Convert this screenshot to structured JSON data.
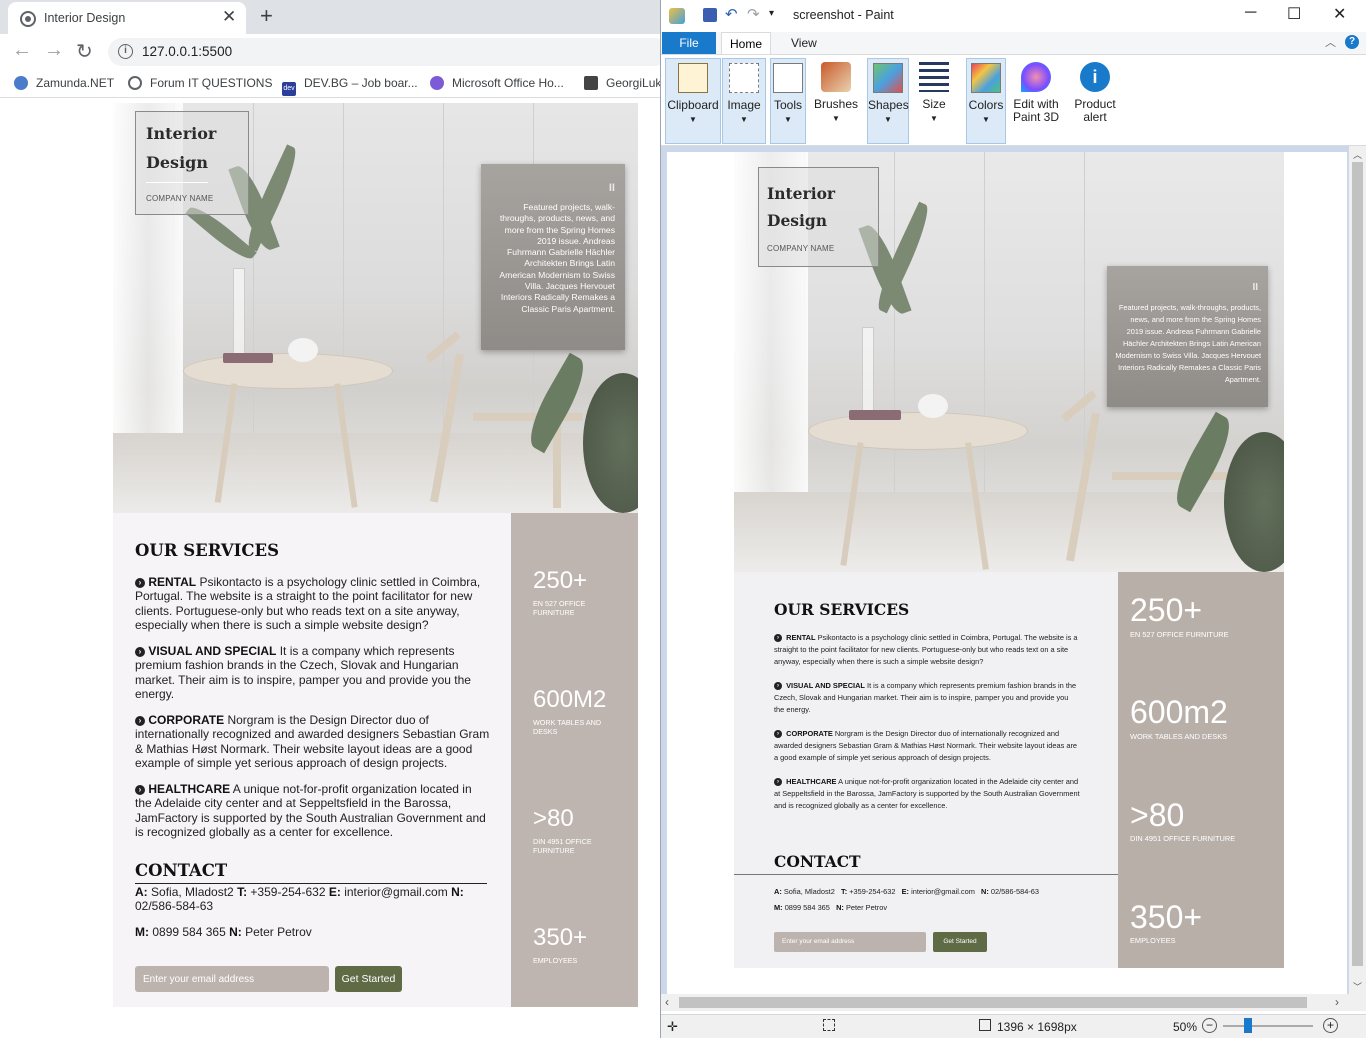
{
  "browser": {
    "tab_title": "Interior Design",
    "tab_close": "✕",
    "new_tab": "+",
    "url": "127.0.0.1:5500",
    "bookmarks": [
      "Zamunda.NET",
      "Forum IT QUESTIONS",
      "DEV.BG – Job boar...",
      "Microsoft Office Ho...",
      "GeorgiLuk"
    ],
    "bookmark_dev_icon": "dev"
  },
  "site": {
    "logo_line1": "Interior",
    "logo_line2": "Design",
    "company": "COMPANY NAME",
    "pause": "II",
    "featured": "Featured projects, walk-throughs, products, news, and more from the Spring Homes 2019 issue. Andreas Fuhrmann Gabrielle Hächler Architekten Brings Latin American Modernism to Swiss Villa. Jacques Hervouet Interiors Radically Remakes a Classic Paris Apartment.",
    "services_title": "OUR SERVICES",
    "services": [
      {
        "name": "RENTAL",
        "text": "Psikontacto is a psychology clinic settled in Coimbra, Portugal. The website is a straight to the point facilitator for new clients. Portuguese-only but who reads text on a site anyway, especially when there is such a simple website design?"
      },
      {
        "name": "VISUAL AND SPECIAL",
        "text": "It is a company which represents premium fashion brands in the Czech, Slovak and Hungarian market. Their aim is to inspire, pamper you and provide you the energy."
      },
      {
        "name": "CORPORATE",
        "text": "Norgram is the Design Director duo of internationally recognized and awarded designers Sebastian Gram & Mathias Høst Normark. Their website layout ideas are a good example of simple yet serious approach of design projects."
      },
      {
        "name": "HEALTHCARE",
        "text": "A unique not-for-profit organization located in the Adelaide city center and at Seppeltsfield in the Barossa, JamFactory is supported by the South Australian Government and is recognized globally as a center for excellence."
      }
    ],
    "contact_title": "CONTACT",
    "contact": {
      "a_label": "A:",
      "a": "Sofia, Mladost2",
      "t_label": "T:",
      "t": "+359-254-632",
      "e_label": "E:",
      "e": "interior@gmail.com",
      "n_label": "N:",
      "n": "02/586-584-63",
      "m_label": "M:",
      "m": "0899 584 365",
      "n2_label": "N:",
      "n2": "Peter Petrov"
    },
    "email_placeholder": "Enter your email address",
    "cta": "Get Started",
    "stats_browser": [
      {
        "num": "250+",
        "label": "EN 527 OFFICE FURNITURE"
      },
      {
        "num": "600M2",
        "label": "WORK TABLES AND DESKS"
      },
      {
        "num": ">80",
        "label": "DIN 4951 OFFICE FURNITURE"
      },
      {
        "num": "350+",
        "label": "EMPLOYEES"
      }
    ],
    "stats_paint": [
      {
        "num": "250+",
        "label": "EN 527 OFFICE FURNITURE"
      },
      {
        "num": "600m2",
        "label": "WORK TABLES AND DESKS"
      },
      {
        "num": ">80",
        "label": "DIN 4951 OFFICE FURNITURE"
      },
      {
        "num": "350+",
        "label": "EMPLOYEES"
      }
    ]
  },
  "paint": {
    "title": "screenshot - Paint",
    "menu": {
      "file": "File",
      "home": "Home",
      "view": "View"
    },
    "tools": [
      "Clipboard",
      "Image",
      "Tools",
      "Brushes",
      "Shapes",
      "Size",
      "Colors",
      "Edit with Paint 3D",
      "Product alert"
    ],
    "dimensions": "1396 × 1698px",
    "zoom": "50%"
  },
  "colors": {
    "stats_bg": "#bfb5b0",
    "services_bg": "#f6f4f6",
    "cta_bg": "#5e6b45",
    "paint_file_tab": "#1979ca"
  }
}
